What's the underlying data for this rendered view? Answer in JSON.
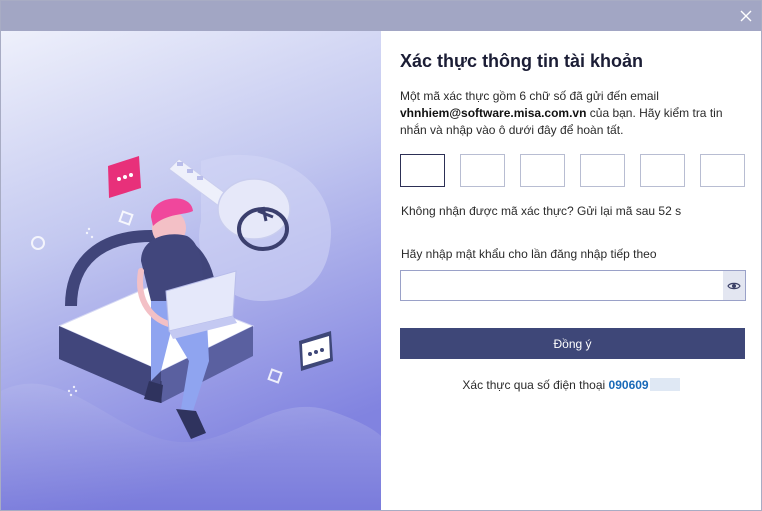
{
  "window": {
    "close_icon": "close-icon"
  },
  "verify": {
    "title": "Xác thực thông tin tài khoản",
    "desc_prefix": "Một mã xác thực gồm 6 chữ số đã gửi đến email",
    "email": "vhnhiem@software.misa.com.vn",
    "desc_suffix": "của bạn. Hãy kiểm tra tin nhắn và nhập vào ô dưới đây để hoàn tất.",
    "otp_values": [
      "",
      "",
      "",
      "",
      "",
      ""
    ],
    "resend_text": "Không nhận được mã xác thực? Gửi lại mã sau 52 s"
  },
  "password": {
    "label": "Hãy nhập mật khẩu cho lần đăng nhập tiếp theo",
    "value": "",
    "toggle_icon": "eye-icon"
  },
  "submit": {
    "label": "Đồng ý"
  },
  "phone": {
    "prefix": "Xác thực qua số điện thoại",
    "number": "090609"
  },
  "colors": {
    "titlebar": "#a2a6c4",
    "primary_button": "#3e4778",
    "link": "#1a6ab8",
    "illustration_bg_top": "#dfe3f8",
    "illustration_bg_bottom": "#7e7fe0",
    "character_hair": "#f0479c",
    "chat_bubble": "#e8307a"
  }
}
